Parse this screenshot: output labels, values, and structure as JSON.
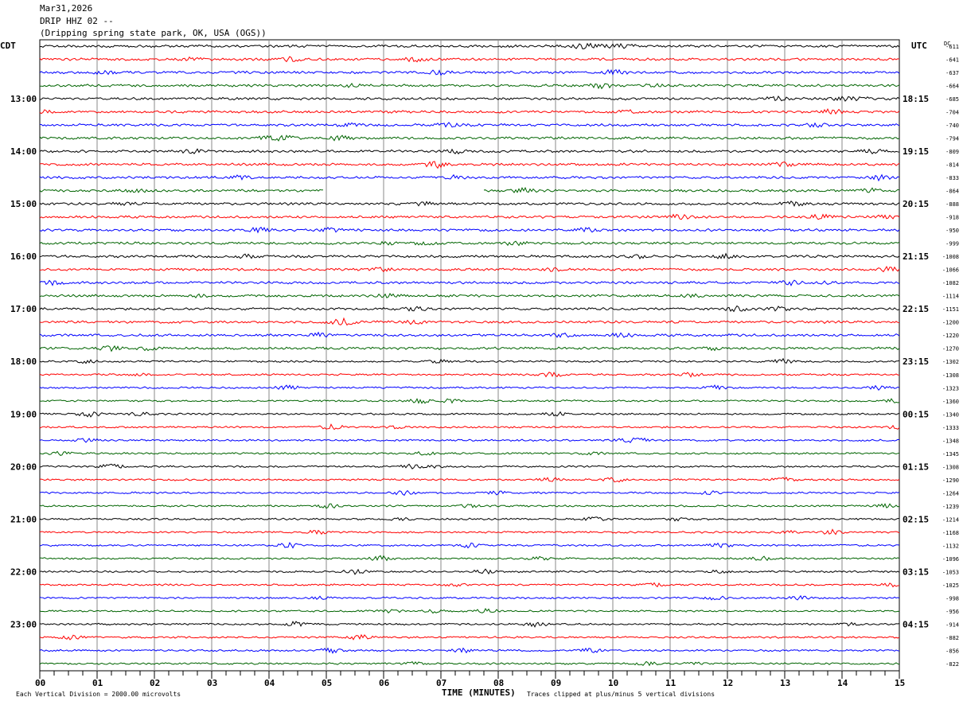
{
  "header": {
    "date": "Mar31,2026",
    "station": "DRIP HHZ 02 --",
    "location": "(Dripping spring state park, OK, USA (OGS))"
  },
  "chart_data": {
    "type": "line",
    "title": "DRIP HHZ 02 -- helicorder",
    "left_axis_label": "CDT",
    "right_axis_label": "UTC",
    "dc_label": "DC",
    "xlabel": "TIME (MINUTES)",
    "x_ticks": [
      "00",
      "01",
      "02",
      "03",
      "04",
      "05",
      "06",
      "07",
      "08",
      "09",
      "10",
      "11",
      "12",
      "13",
      "14",
      "15"
    ],
    "xlim": [
      0,
      15
    ],
    "cdt_hour_labels": [
      "13:00",
      "14:00",
      "15:00",
      "16:00",
      "17:00",
      "18:00",
      "19:00",
      "20:00",
      "21:00",
      "22:00",
      "23:00"
    ],
    "utc_hour_labels": [
      "18:15",
      "19:15",
      "20:15",
      "21:15",
      "22:15",
      "23:15",
      "00:15",
      "01:15",
      "02:15",
      "03:15",
      "04:15"
    ],
    "trace_colors": [
      "#000000",
      "#ff0000",
      "#0000ff",
      "#006400"
    ],
    "trace_count": 48,
    "dc_offsets": [
      -611,
      -641,
      -637,
      -664,
      -685,
      -704,
      -740,
      -794,
      -809,
      -814,
      -833,
      -864,
      -888,
      -918,
      -950,
      -999,
      -1008,
      -1066,
      -1082,
      -1114,
      -1151,
      -1200,
      -1220,
      -1270,
      -1302,
      -1308,
      -1323,
      -1360,
      -1340,
      -1333,
      -1348,
      -1345,
      -1308,
      -1290,
      -1264,
      -1239,
      -1214,
      -1168,
      -1132,
      -1096,
      -1053,
      -1025,
      -998,
      -956,
      -914,
      -882,
      -856,
      -822
    ],
    "data_gaps": [
      {
        "trace": 11,
        "from_min": 4.97,
        "to_min": 7.75
      }
    ]
  },
  "footer": {
    "scale_note": "Each Vertical Division = 2000.00 microvolts",
    "clip_note": "Traces clipped at plus/minus 5 vertical divisions"
  }
}
